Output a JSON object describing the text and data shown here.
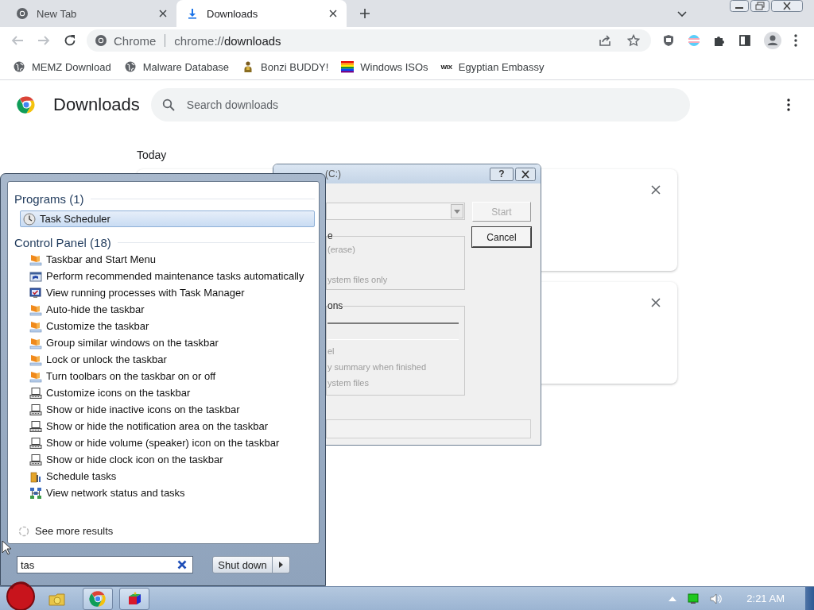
{
  "browser": {
    "tabs": [
      {
        "title": "New Tab",
        "kind": "browser",
        "selected": false
      },
      {
        "title": "Downloads",
        "kind": "download",
        "selected": true
      }
    ],
    "omnibox": {
      "site": "Chrome",
      "scheme": "chrome://",
      "path": "downloads"
    },
    "bookmarks": [
      {
        "label": "MEMZ Download",
        "kind": "globe"
      },
      {
        "label": "Malware Database",
        "kind": "globe"
      },
      {
        "label": "Bonzi BUDDY!",
        "kind": "figure"
      },
      {
        "label": "Windows ISOs",
        "kind": "rainbow"
      },
      {
        "label": "Egyptian Embassy",
        "kind": "wordmark",
        "mark": "WIX"
      }
    ]
  },
  "downloads_page": {
    "title": "Downloads",
    "search": {
      "placeholder": "Search downloads"
    },
    "date_heading": "Today",
    "cards": [
      {
        "removable": true
      },
      {
        "removable": true
      }
    ]
  },
  "format_dialog": {
    "title": "(C:)",
    "help_label": "?",
    "progress": {
      "level": 0
    },
    "buttons": [
      {
        "label": "Start",
        "disabled": true
      },
      {
        "label": "Cancel",
        "disabled": false
      }
    ],
    "groups": [
      {
        "heading": "e",
        "lines": [
          "(erase)",
          "ystem files only"
        ],
        "has_field": false
      },
      {
        "heading": "ons",
        "lines": [
          "el",
          "y summary when finished",
          "ystem files"
        ],
        "has_field": true
      }
    ]
  },
  "start_menu": {
    "groups": [
      {
        "heading": "Programs (1)",
        "items": [
          {
            "label": "Task Scheduler",
            "kind": "clock",
            "selected": true
          }
        ]
      },
      {
        "heading": "Control Panel (18)",
        "items": [
          {
            "label": "Taskbar and Start Menu",
            "kind": "taskbar",
            "selected": false
          },
          {
            "label": "Perform recommended maintenance tasks automatically",
            "kind": "maintenance",
            "selected": false
          },
          {
            "label": "View running processes with Task Manager",
            "kind": "taskmgr",
            "selected": false
          },
          {
            "label": "Auto-hide the taskbar",
            "kind": "taskbar",
            "selected": false
          },
          {
            "label": "Customize the taskbar",
            "kind": "taskbar",
            "selected": false
          },
          {
            "label": "Group similar windows on the taskbar",
            "kind": "taskbar",
            "selected": false
          },
          {
            "label": "Lock or unlock the taskbar",
            "kind": "taskbar",
            "selected": false
          },
          {
            "label": "Turn toolbars on the taskbar on or off",
            "kind": "taskbar",
            "selected": false
          },
          {
            "label": "Customize icons on the taskbar",
            "kind": "computer",
            "selected": false
          },
          {
            "label": "Show or hide inactive icons on the taskbar",
            "kind": "computer",
            "selected": false
          },
          {
            "label": "Show or hide the notification area on the taskbar",
            "kind": "computer",
            "selected": false
          },
          {
            "label": "Show or hide volume (speaker) icon on the taskbar",
            "kind": "computer",
            "selected": false
          },
          {
            "label": "Show or hide clock icon on the taskbar",
            "kind": "computer",
            "selected": false
          },
          {
            "label": "Schedule tasks",
            "kind": "tools",
            "selected": false
          },
          {
            "label": "View network status and tasks",
            "kind": "network",
            "selected": false
          }
        ]
      }
    ],
    "see_more": "See more results",
    "search": {
      "value": "tas"
    },
    "shutdown": "Shut down"
  },
  "taskbar": {
    "buttons": [
      {
        "kind": "folder",
        "active": false
      },
      {
        "kind": "browser",
        "active": true
      },
      {
        "kind": "app",
        "active": true
      }
    ],
    "clock": "2:21 AM"
  }
}
